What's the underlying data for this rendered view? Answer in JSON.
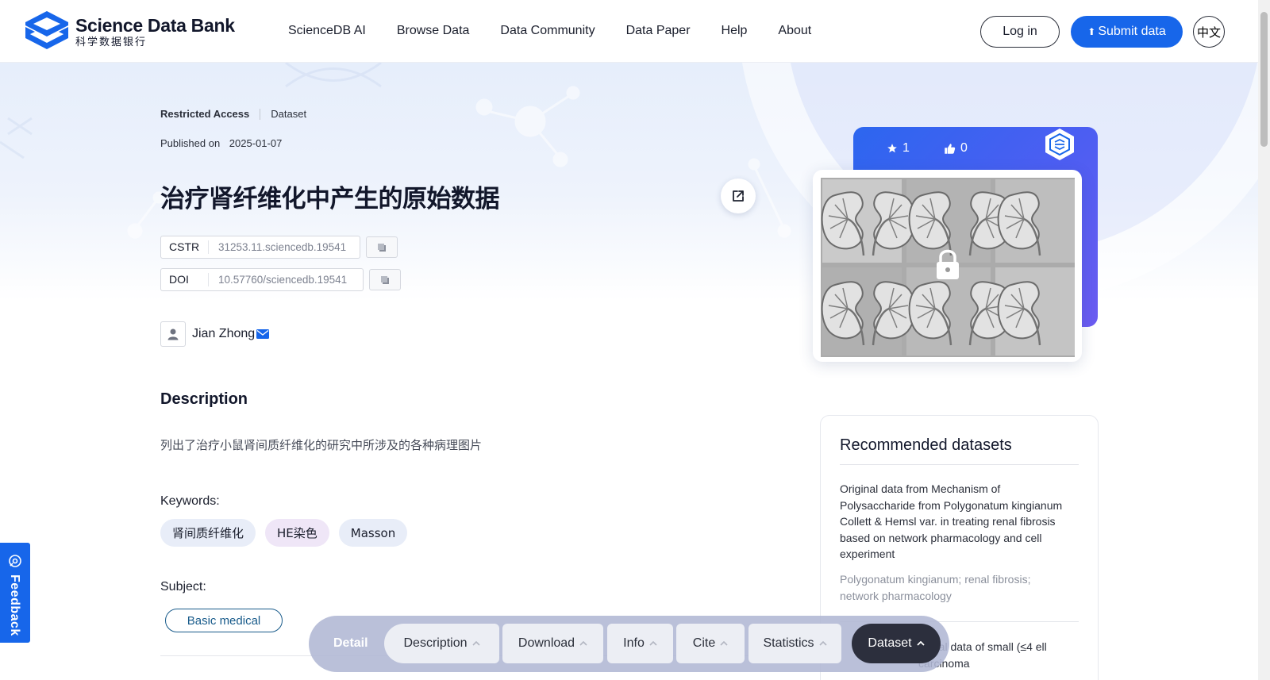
{
  "header": {
    "logo_en": "Science Data Bank",
    "logo_zh": "科学数据银行",
    "nav": [
      "ScienceDB AI",
      "Browse Data",
      "Data Community",
      "Data Paper",
      "Help",
      "About"
    ],
    "login_label": "Log in",
    "submit_label": "Submit data",
    "lang_label": "中文"
  },
  "dataset": {
    "access": "Restricted Access",
    "type": "Dataset",
    "published_label": "Published on",
    "published_date": "2025-01-07",
    "title": "治疗肾纤维化中产生的原始数据",
    "cstr_label": "CSTR",
    "cstr_value": "31253.11.sciencedb.19541",
    "doi_label": "DOI",
    "doi_value": "10.57760/sciencedb.19541",
    "author": "Jian Zhong",
    "description_heading": "Description",
    "description": "列出了治疗小鼠肾间质纤维化的研究中所涉及的各种病理图片",
    "keywords_label": "Keywords:",
    "keywords": [
      "肾间质纤维化",
      "HE染色",
      "Masson"
    ],
    "subject_label": "Subject:",
    "subject": "Basic medical"
  },
  "stats": {
    "stars": "1",
    "likes": "0"
  },
  "recommended": {
    "heading": "Recommended datasets",
    "item1_title": "Original data from Mechanism of Polysaccharide from Polygonatum kingianum Collett & Hemsl var. in treating renal fibrosis based on network pharmacology and cell experiment",
    "item1_keywords": "Polygonatum kingianum; renal fibrosis; network pharmacology",
    "item2_title_partial": "ogical data of small (≤4 ell carcinoma"
  },
  "feedback_label": "Feedback",
  "bottom_nav": {
    "detail": "Detail",
    "items": [
      "Description",
      "Download",
      "Info",
      "Cite",
      "Statistics",
      "Dataset"
    ],
    "active": "Dataset"
  },
  "colors": {
    "brand_blue": "#1766ea",
    "card_gradient_start": "#2c66ef",
    "card_gradient_end": "#6c5cf1",
    "subject_chip": "#175a8a"
  }
}
